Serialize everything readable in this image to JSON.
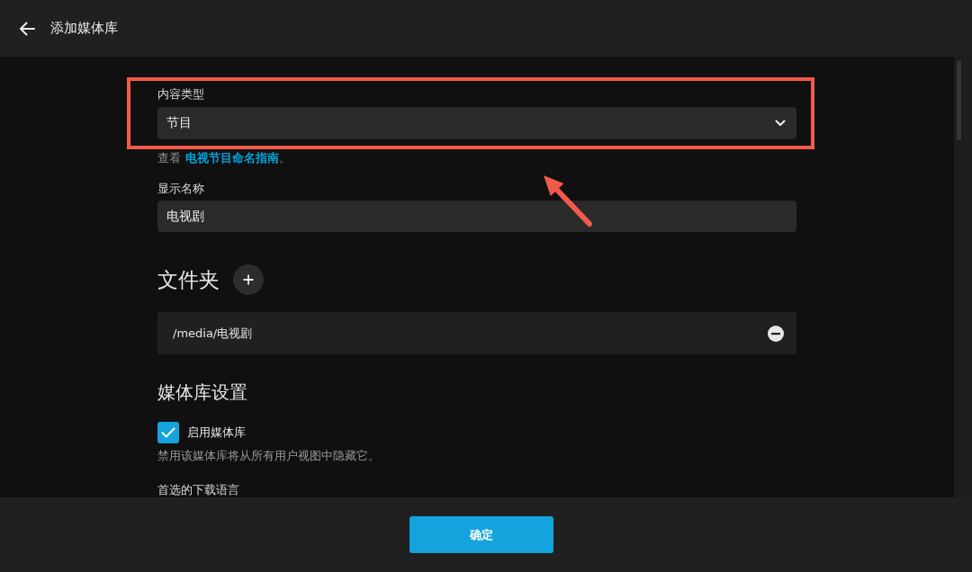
{
  "header": {
    "title": "添加媒体库"
  },
  "form": {
    "content_type": {
      "label": "内容类型",
      "value": "节目"
    },
    "help": {
      "prefix": "查看",
      "link": "电视节目命名指南",
      "suffix": "。"
    },
    "display_name": {
      "label": "显示名称",
      "value": "电视剧"
    },
    "folders": {
      "heading": "文件夹",
      "items": [
        {
          "path": "/media/电视剧"
        }
      ]
    },
    "library_settings": {
      "heading": "媒体库设置",
      "options": [
        {
          "kind": "checkbox",
          "label": "启用媒体库",
          "checked": true,
          "description": "禁用该媒体库将从所有用户视图中隐藏它。"
        }
      ],
      "next_label": "首选的下载语言"
    }
  },
  "footer": {
    "buttons": [
      {
        "label": "确定",
        "kind": "primary"
      }
    ]
  }
}
